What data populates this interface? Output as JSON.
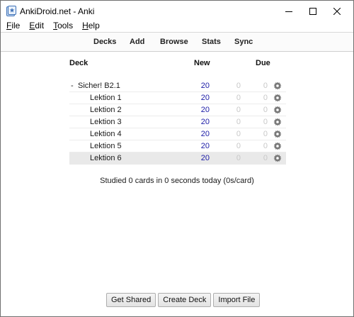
{
  "window": {
    "title": "AnkiDroid.net - Anki"
  },
  "menu": {
    "items": [
      {
        "label": "File",
        "underline": "F",
        "rest": "ile"
      },
      {
        "label": "Edit",
        "underline": "E",
        "rest": "dit"
      },
      {
        "label": "Tools",
        "underline": "T",
        "rest": "ools"
      },
      {
        "label": "Help",
        "underline": "H",
        "rest": "elp"
      }
    ]
  },
  "toolbar": {
    "decks": "Decks",
    "add": "Add",
    "browse": "Browse",
    "stats": "Stats",
    "sync": "Sync"
  },
  "table": {
    "headers": {
      "deck": "Deck",
      "new": "New",
      "due": "Due"
    },
    "parent": {
      "toggle": "-",
      "name": "Sicher! B2.1",
      "new": "20",
      "learn": "0",
      "due": "0"
    },
    "children": [
      {
        "name": "Lektion 1",
        "new": "20",
        "learn": "0",
        "due": "0"
      },
      {
        "name": "Lektion 2",
        "new": "20",
        "learn": "0",
        "due": "0"
      },
      {
        "name": "Lektion 3",
        "new": "20",
        "learn": "0",
        "due": "0"
      },
      {
        "name": "Lektion 4",
        "new": "20",
        "learn": "0",
        "due": "0"
      },
      {
        "name": "Lektion 5",
        "new": "20",
        "learn": "0",
        "due": "0"
      },
      {
        "name": "Lektion 6",
        "new": "20",
        "learn": "0",
        "due": "0"
      }
    ]
  },
  "studied": "Studied 0 cards in 0 seconds today (0s/card)",
  "buttons": {
    "get_shared": "Get Shared",
    "create_deck": "Create Deck",
    "import_file": "Import File"
  },
  "colors": {
    "new": "#1a1aa6",
    "muted": "#c8c8c8",
    "current_row": "#e9e9e9"
  },
  "icons": {
    "app": "anki-app-icon",
    "gear": "gear-icon"
  }
}
